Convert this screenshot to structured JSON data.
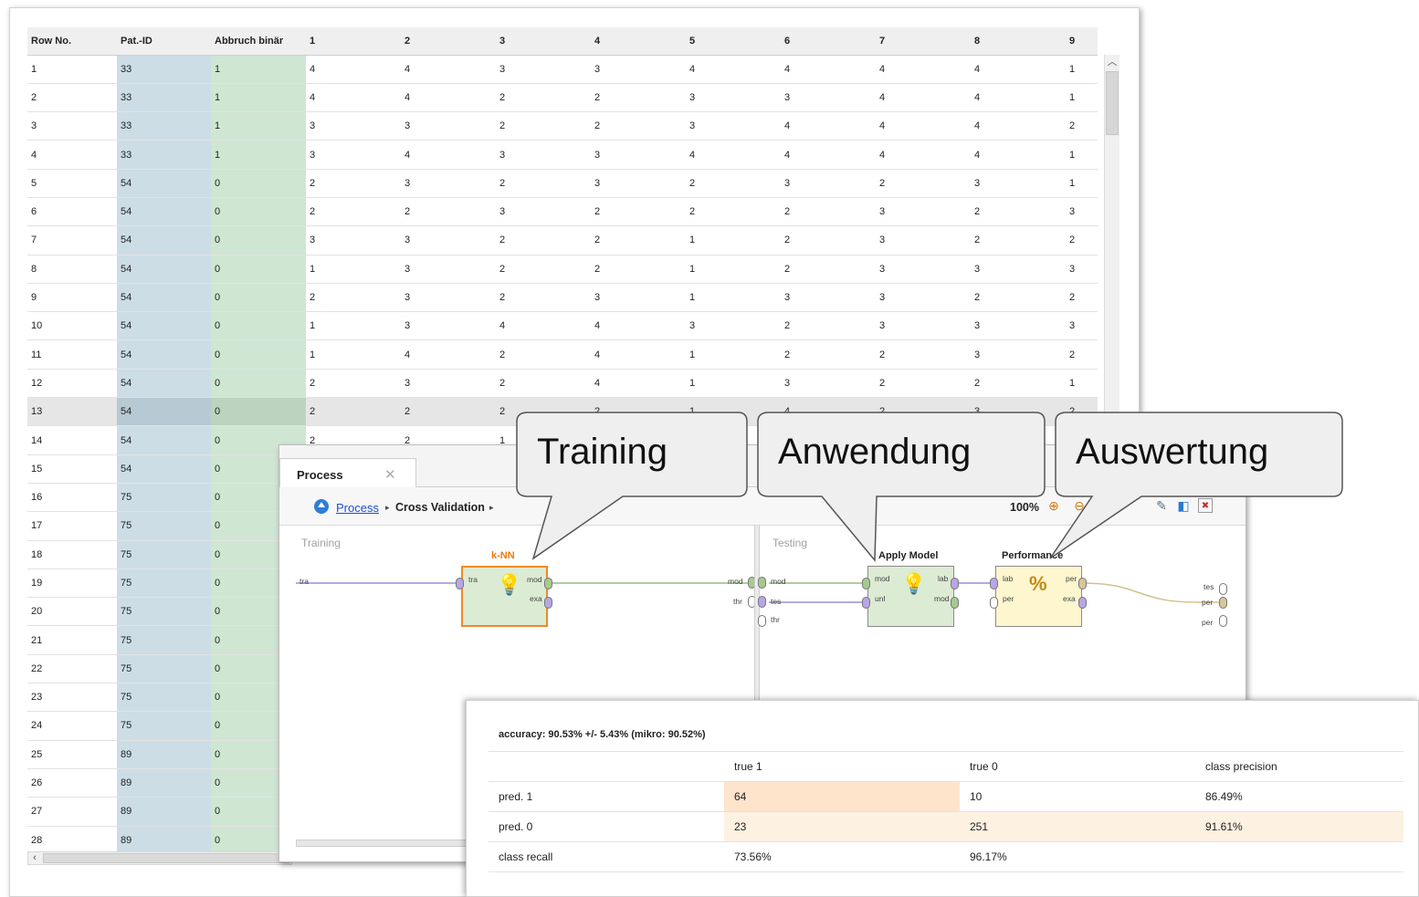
{
  "data_table": {
    "headers": [
      "Row No.",
      "Pat.-ID",
      "Abbruch binär",
      "1",
      "2",
      "3",
      "4",
      "5",
      "6",
      "7",
      "8",
      "9"
    ],
    "rows": [
      [
        "1",
        "33",
        "1",
        "4",
        "4",
        "3",
        "3",
        "4",
        "4",
        "4",
        "4",
        "1"
      ],
      [
        "2",
        "33",
        "1",
        "4",
        "4",
        "2",
        "2",
        "3",
        "3",
        "4",
        "4",
        "1"
      ],
      [
        "3",
        "33",
        "1",
        "3",
        "3",
        "2",
        "2",
        "3",
        "4",
        "4",
        "4",
        "2"
      ],
      [
        "4",
        "33",
        "1",
        "3",
        "4",
        "3",
        "3",
        "4",
        "4",
        "4",
        "4",
        "1"
      ],
      [
        "5",
        "54",
        "0",
        "2",
        "3",
        "2",
        "3",
        "2",
        "3",
        "2",
        "3",
        "1"
      ],
      [
        "6",
        "54",
        "0",
        "2",
        "2",
        "3",
        "2",
        "2",
        "2",
        "3",
        "2",
        "3"
      ],
      [
        "7",
        "54",
        "0",
        "3",
        "3",
        "2",
        "2",
        "1",
        "2",
        "3",
        "2",
        "2"
      ],
      [
        "8",
        "54",
        "0",
        "1",
        "3",
        "2",
        "2",
        "1",
        "2",
        "3",
        "3",
        "3"
      ],
      [
        "9",
        "54",
        "0",
        "2",
        "3",
        "2",
        "3",
        "1",
        "3",
        "3",
        "2",
        "2"
      ],
      [
        "10",
        "54",
        "0",
        "1",
        "3",
        "4",
        "4",
        "3",
        "2",
        "3",
        "3",
        "3"
      ],
      [
        "11",
        "54",
        "0",
        "1",
        "4",
        "2",
        "4",
        "1",
        "2",
        "2",
        "3",
        "2"
      ],
      [
        "12",
        "54",
        "0",
        "2",
        "3",
        "2",
        "4",
        "1",
        "3",
        "2",
        "2",
        "1"
      ],
      [
        "13",
        "54",
        "0",
        "2",
        "2",
        "2",
        "2",
        "1",
        "4",
        "2",
        "3",
        "2"
      ],
      [
        "14",
        "54",
        "0",
        "2",
        "2",
        "1",
        "",
        "",
        "",
        "",
        "",
        ""
      ],
      [
        "15",
        "54",
        "0",
        "",
        "",
        "",
        "",
        "",
        "",
        "",
        "",
        ""
      ],
      [
        "16",
        "75",
        "0",
        "",
        "",
        "",
        "",
        "",
        "",
        "",
        "",
        ""
      ],
      [
        "17",
        "75",
        "0",
        "",
        "",
        "",
        "",
        "",
        "",
        "",
        "",
        ""
      ],
      [
        "18",
        "75",
        "0",
        "",
        "",
        "",
        "",
        "",
        "",
        "",
        "",
        ""
      ],
      [
        "19",
        "75",
        "0",
        "",
        "",
        "",
        "",
        "",
        "",
        "",
        "",
        ""
      ],
      [
        "20",
        "75",
        "0",
        "",
        "",
        "",
        "",
        "",
        "",
        "",
        "",
        ""
      ],
      [
        "21",
        "75",
        "0",
        "",
        "",
        "",
        "",
        "",
        "",
        "",
        "",
        ""
      ],
      [
        "22",
        "75",
        "0",
        "",
        "",
        "",
        "",
        "",
        "",
        "",
        "",
        ""
      ],
      [
        "23",
        "75",
        "0",
        "",
        "",
        "",
        "",
        "",
        "",
        "",
        "",
        ""
      ],
      [
        "24",
        "75",
        "0",
        "",
        "",
        "",
        "",
        "",
        "",
        "",
        "",
        ""
      ],
      [
        "25",
        "89",
        "0",
        "",
        "",
        "",
        "",
        "",
        "",
        "",
        "",
        ""
      ],
      [
        "26",
        "89",
        "0",
        "",
        "",
        "",
        "",
        "",
        "",
        "",
        "",
        ""
      ],
      [
        "27",
        "89",
        "0",
        "",
        "",
        "",
        "",
        "",
        "",
        "",
        "",
        ""
      ],
      [
        "28",
        "89",
        "0",
        "",
        "",
        "",
        "",
        "",
        "",
        "",
        "",
        ""
      ]
    ],
    "selected_row": 13
  },
  "process": {
    "tab_title": "Process",
    "tab_close": "✕",
    "breadcrumb": {
      "process": "Process",
      "sep": "▸",
      "current": "Cross Validation"
    },
    "zoom": "100%",
    "training_title": "Training",
    "testing_title": "Testing",
    "operators": {
      "knn": {
        "title": "k-NN",
        "in_ports": [
          "tra"
        ],
        "out_ports": [
          "mod",
          "exa"
        ]
      },
      "apply": {
        "title": "Apply Model",
        "in_ports": [
          "mod",
          "unl"
        ],
        "out_ports": [
          "lab",
          "mod"
        ]
      },
      "perf": {
        "title": "Performance",
        "in_ports": [
          "lab",
          "per"
        ],
        "out_ports": [
          "per",
          "exa"
        ]
      }
    },
    "training_ports": {
      "left_in": "tra",
      "right_out1": "mod",
      "right_out2": "thr"
    },
    "testing_ports": {
      "left1": "mod",
      "left2": "tes",
      "left3": "thr",
      "right1": "tes",
      "right2": "per",
      "right3": "per"
    }
  },
  "performance": {
    "title": "accuracy: 90.53% +/- 5.43% (mikro: 90.52%)",
    "header": [
      "",
      "true 1",
      "true 0",
      "class precision"
    ],
    "rows": [
      [
        "pred. 1",
        "64",
        "10",
        "86.49%"
      ],
      [
        "pred. 0",
        "23",
        "251",
        "91.61%"
      ],
      [
        "class recall",
        "73.56%",
        "96.17%",
        ""
      ]
    ]
  },
  "callouts": {
    "training": "Training",
    "apply": "Anwendung",
    "eval": "Auswertung"
  },
  "colors": {
    "pid_column": "#ccdde6",
    "label_column": "#cfe6d3",
    "knn_border": "#f08a24",
    "knn_title": "#f07a10",
    "operator_green": "#dcebd3",
    "operator_yellow": "#fdf6cf",
    "port_purple": "#b7a6e6",
    "port_green": "#a7c98f",
    "port_tan": "#d6c69a"
  }
}
